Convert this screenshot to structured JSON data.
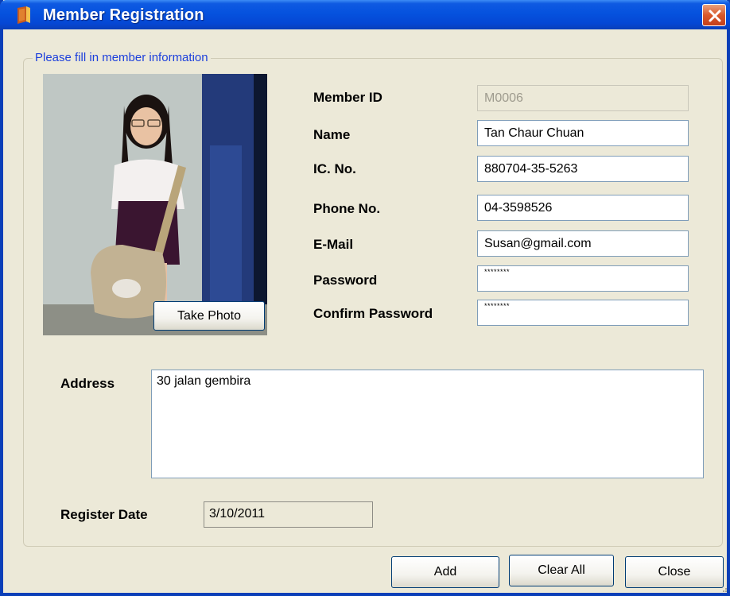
{
  "window": {
    "title": "Member Registration"
  },
  "group": {
    "legend": "Please fill in member information"
  },
  "photo": {
    "take_photo_label": "Take Photo"
  },
  "fields": {
    "member_id": {
      "label": "Member ID",
      "value": "M0006"
    },
    "name": {
      "label": "Name",
      "value": "Tan Chaur Chuan"
    },
    "ic_no": {
      "label": "IC. No.",
      "value": "880704-35-5263"
    },
    "phone_no": {
      "label": "Phone No.",
      "value": "04-3598526"
    },
    "email": {
      "label": "E-Mail",
      "value": "Susan@gmail.com"
    },
    "password": {
      "label": "Password",
      "value": "********"
    },
    "confirm_password": {
      "label": "Confirm Password",
      "value": "********"
    }
  },
  "address": {
    "label": "Address",
    "value": "30 jalan gembira"
  },
  "register_date": {
    "label": "Register Date",
    "value": "3/10/2011"
  },
  "buttons": {
    "add": "Add",
    "clear_all": "Clear All",
    "close": "Close"
  },
  "colors": {
    "titlebar": "#0552de",
    "window_bg": "#ece9d8",
    "legend_text": "#1c3fdc",
    "close_button": "#d9582b"
  },
  "icons": {
    "app": "book-icon",
    "close": "close-x-icon"
  }
}
